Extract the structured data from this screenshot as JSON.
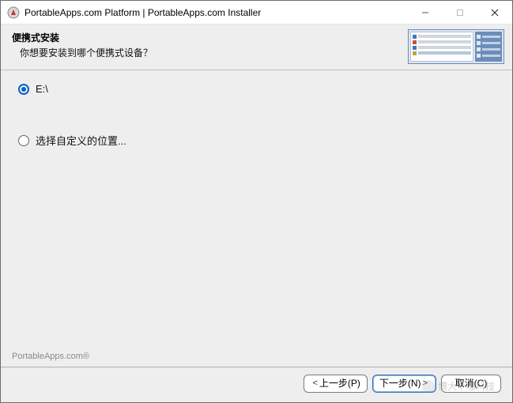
{
  "titlebar": {
    "title": "PortableApps.com Platform | PortableApps.com Installer"
  },
  "header": {
    "title": "便携式安装",
    "subtitle": "你想要安装到哪个便携式设备？"
  },
  "options": {
    "drive": "E:\\",
    "custom": "选择自定义的位置..."
  },
  "footer": {
    "brand": "PortableApps.com®"
  },
  "buttons": {
    "back": "上一步(P)",
    "next": "下一步(N)",
    "cancel": "取消(C)"
  },
  "watermark": {
    "text": "博大个噬科技"
  }
}
